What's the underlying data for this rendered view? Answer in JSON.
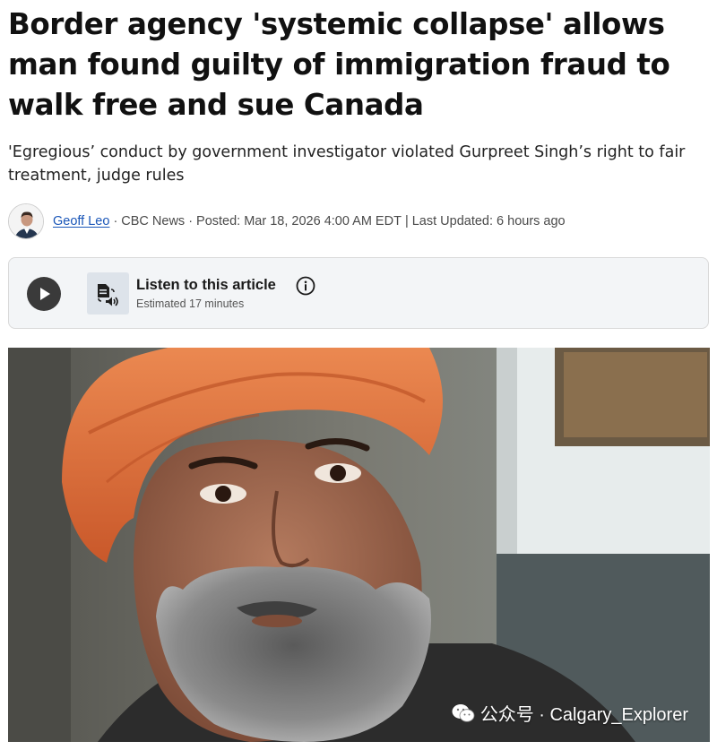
{
  "article": {
    "headline": "Border agency 'systemic collapse' allows man found guilty of immigration fraud to walk free and sue Canada",
    "deck": "'Egregious’ conduct by government investigator violated Gurpreet Singh’s right to fair treatment, judge rules"
  },
  "byline": {
    "author": "Geoff Leo",
    "outlet": "CBC News",
    "posted": "Posted: Mar 18, 2026 4:00 AM EDT",
    "updated": "Last Updated: 6 hours ago"
  },
  "listen": {
    "title": "Listen to this article",
    "estimate": "Estimated 17 minutes"
  },
  "watermark": {
    "text": "公众号 · Calgary_Explorer",
    "logo": "wechat-logo"
  },
  "colors": {
    "link": "#1a56b8",
    "turban": "#e2713a",
    "listen_box_bg": "#f3f5f7"
  }
}
